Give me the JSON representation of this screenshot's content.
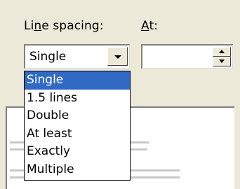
{
  "line_spacing_label": {
    "pre": "Li",
    "key": "n",
    "post": "e spacing:"
  },
  "at_label": {
    "key": "A",
    "post": "t:"
  },
  "line_spacing_value": "Single",
  "at_value": "",
  "dropdown_options": [
    "Single",
    "1.5 lines",
    "Double",
    "At least",
    "Exactly",
    "Multiple"
  ],
  "selected_index": 0,
  "icons": {
    "dropdown": "chevron-down-icon",
    "spin_up": "spin-up-icon",
    "spin_down": "spin-down-icon"
  },
  "colors": {
    "dialog_bg": "#ece9d8",
    "highlight": "#316ac5"
  }
}
